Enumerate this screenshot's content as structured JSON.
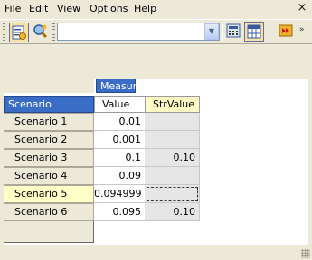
{
  "menu": {
    "file": "File",
    "edit": "Edit",
    "view": "View",
    "options": "Options",
    "help": "Help",
    "close_glyph": "×"
  },
  "toolbar": {
    "combo_value": "",
    "icons": [
      "open-report-icon",
      "query-icon",
      "dropdown-arrow-icon",
      "calculator-icon",
      "grid-view-icon",
      "run-icon"
    ]
  },
  "pivot": {
    "measure_header": "Measure",
    "scenario_header": "Scenario",
    "columns": [
      "Value",
      "StrValue"
    ],
    "rows": [
      {
        "scenario": "Scenario 1",
        "value": "0.01",
        "str": ""
      },
      {
        "scenario": "Scenario 2",
        "value": "0.001",
        "str": ""
      },
      {
        "scenario": "Scenario 3",
        "value": "0.1",
        "str": "0.10"
      },
      {
        "scenario": "Scenario 4",
        "value": "0.09",
        "str": ""
      },
      {
        "scenario": "Scenario 5",
        "value": "0.094999",
        "str": ""
      },
      {
        "scenario": "Scenario 6",
        "value": "0.095",
        "str": "0.10"
      }
    ],
    "selected_row": 5
  },
  "colors": {
    "header_blue": "#3a6ec6",
    "selected_yellow": "#ffffc8"
  }
}
